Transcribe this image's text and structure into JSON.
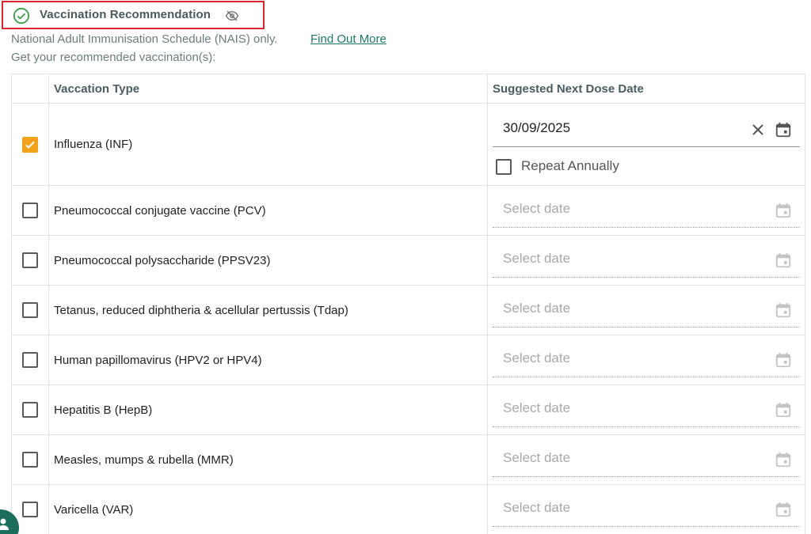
{
  "header": {
    "title": "Vaccination Recommendation",
    "status_icon": "check-circle-icon",
    "visibility_icon": "eye-off-icon",
    "accent_color": "#3aa04a",
    "highlight_color": "#d6262e"
  },
  "intro": {
    "schedule_text": "National Adult Immunisation Schedule (NAIS) only.",
    "find_out_more": "Find Out More",
    "recommend_text": "Get your recommended vaccination(s):"
  },
  "table": {
    "col_type": "Vaccation Type",
    "col_date": "Suggested Next Dose Date",
    "rows": [
      {
        "name": "Influenza (INF)",
        "checked": true,
        "date": "30/09/2025",
        "repeat_label": "Repeat Annually",
        "repeat_checked": false
      },
      {
        "name": "Pneumococcal conjugate vaccine (PCV)",
        "checked": false,
        "placeholder": "Select date"
      },
      {
        "name": "Pneumococcal polysaccharide (PPSV23)",
        "checked": false,
        "placeholder": "Select date"
      },
      {
        "name": "Tetanus, reduced diphtheria & acellular pertussis (Tdap)",
        "checked": false,
        "placeholder": "Select date"
      },
      {
        "name": "Human papillomavirus (HPV2 or HPV4)",
        "checked": false,
        "placeholder": "Select date"
      },
      {
        "name": "Hepatitis B (HepB)",
        "checked": false,
        "placeholder": "Select date"
      },
      {
        "name": "Measles, mumps & rubella (MMR)",
        "checked": false,
        "placeholder": "Select date"
      },
      {
        "name": "Varicella (VAR)",
        "checked": false,
        "placeholder": "Select date"
      }
    ]
  },
  "colors": {
    "checkbox_checked": "#f4a21b",
    "link": "#1b7a63",
    "fab": "#1b6e5b"
  },
  "fab": {
    "icon": "person-icon"
  }
}
